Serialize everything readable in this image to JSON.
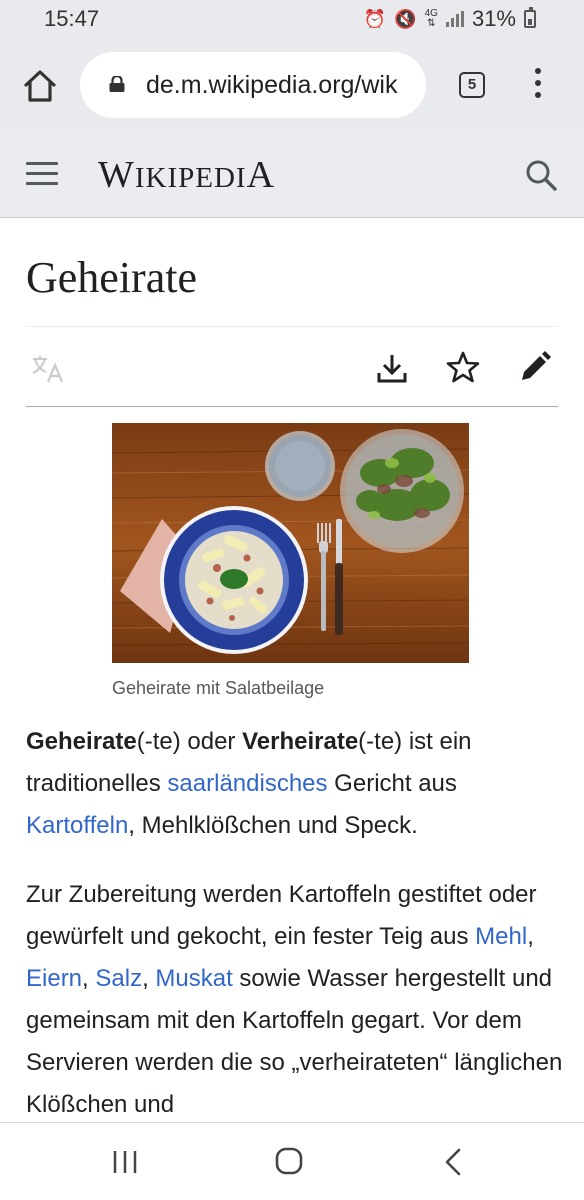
{
  "status": {
    "time": "15:47",
    "network": "4G",
    "battery": "31%"
  },
  "browser": {
    "url": "de.m.wikipedia.org/wik",
    "tab_count": "5"
  },
  "wiki": {
    "wordmark": {
      "w": "W",
      "ikipedi": "IKIPEDI",
      "a": "A"
    }
  },
  "article": {
    "title": "Geheirate",
    "image_caption": "Geheirate mit Salatbeilage",
    "p1": {
      "t1": "Geheirate",
      "t2": "(-te) oder ",
      "t3": "Verheirate",
      "t4": "(-te) ist ein traditionelles ",
      "link1": "saarländisches",
      "t5": " Gericht aus ",
      "link2": "Kartoffeln",
      "t6": ", Mehlklößchen und Speck."
    },
    "p2": {
      "t1": "Zur Zubereitung werden Kartoffeln gestiftet oder gewürfelt und gekocht, ein fester Teig aus ",
      "link1": "Mehl",
      "sep1": ", ",
      "link2": "Eiern",
      "sep2": ", ",
      "link3": "Salz",
      "sep3": ", ",
      "link4": "Muskat",
      "t2": " sowie Wasser hergestellt und gemeinsam mit den Kartoffeln gegart. Vor dem Servieren werden die so „verheirateten“ länglichen Klößchen und"
    }
  },
  "colors": {
    "link": "#3366cc",
    "header_bg": "#eaecf0",
    "chrome_bg": "#e9eaed"
  }
}
